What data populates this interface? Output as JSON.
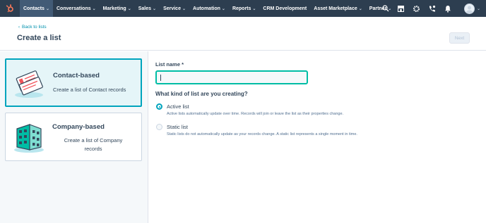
{
  "nav": {
    "items": [
      {
        "label": "Contacts",
        "active": true
      },
      {
        "label": "Conversations"
      },
      {
        "label": "Marketing"
      },
      {
        "label": "Sales"
      },
      {
        "label": "Service"
      },
      {
        "label": "Automation"
      },
      {
        "label": "Reports"
      },
      {
        "label": "CRM Development",
        "no_chevron": true
      },
      {
        "label": "Asset Marketplace"
      },
      {
        "label": "Partner"
      }
    ],
    "chevron": "⌄",
    "icons": [
      "search-icon",
      "marketplace-icon",
      "settings-icon",
      "calling-icon",
      "notifications-icon"
    ],
    "colors": {
      "bg": "#2d3e50",
      "active": "#425b76",
      "logo": "#ff7a59"
    }
  },
  "header": {
    "back_label": "Back to lists",
    "back_arrow": "‹",
    "title": "Create a list",
    "next_label": "Next"
  },
  "cards": {
    "contact": {
      "title": "Contact-based",
      "desc": "Create a list of Contact records",
      "selected": true
    },
    "company": {
      "title": "Company-based",
      "desc_line1": "Create a list of Company",
      "desc_line2": "records",
      "selected": false
    }
  },
  "form": {
    "list_name_label": "List name *",
    "list_name_value": "",
    "question": "What kind of list are you creating?",
    "options": [
      {
        "label": "Active list",
        "help": "Active lists automatically update over time. Records will join or leave the list as their properties change.",
        "checked": true
      },
      {
        "label": "Static list",
        "help": "Static lists do not automatically update as your records change. A static list represents a single moment in time.",
        "checked": false
      }
    ]
  },
  "colors": {
    "accent": "#00a4bd",
    "input_focus": "#00bda5",
    "link": "#0091ae"
  }
}
